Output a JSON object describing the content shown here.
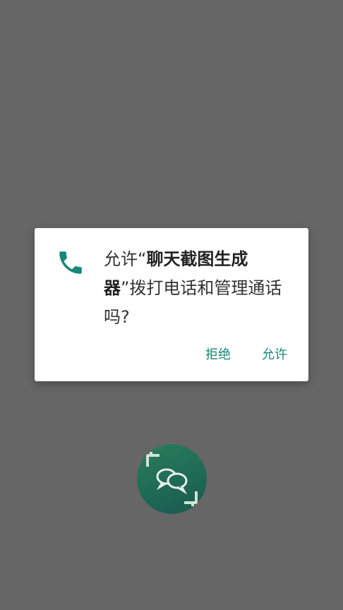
{
  "dialog": {
    "icon": "phone-icon",
    "message_prefix": "允许“",
    "app_name": "聊天截图生成器",
    "message_suffix": "”拨打电话和管理通话吗?",
    "deny_label": "拒绝",
    "allow_label": "允许"
  },
  "background": {
    "logo_icon": "chat-screenshot-app-icon"
  },
  "colors": {
    "accent": "#17877a",
    "scrim": "#666666",
    "dialog_bg": "#ffffff"
  }
}
